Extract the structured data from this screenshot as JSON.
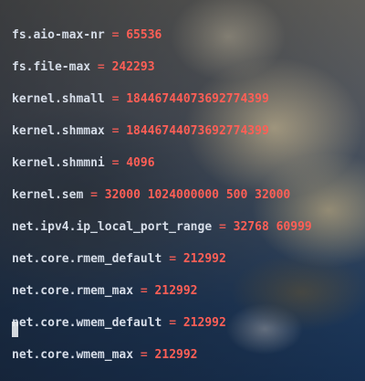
{
  "terminal": {
    "lines": [
      {
        "key": "fs.aio-max-nr",
        "op": " = ",
        "value": "65536"
      },
      {
        "key": "fs.file-max",
        "op": " = ",
        "value": "242293"
      },
      {
        "key": "kernel.shmall",
        "op": " = ",
        "value": "18446744073692774399"
      },
      {
        "key": "kernel.shmmax",
        "op": " = ",
        "value": "18446744073692774399"
      },
      {
        "key": "kernel.shmmni",
        "op": " = ",
        "value": "4096"
      },
      {
        "key": "kernel.sem",
        "op": " = ",
        "value": "32000 1024000000 500 32000"
      },
      {
        "key": "net.ipv4.ip_local_port_range",
        "op": " = ",
        "value": "32768 60999"
      },
      {
        "key": "net.core.rmem_default",
        "op": " = ",
        "value": "212992"
      },
      {
        "key": "net.core.rmem_max",
        "op": " = ",
        "value": "212992"
      },
      {
        "key": "net.core.wmem_default",
        "op": " = ",
        "value": "212992"
      },
      {
        "key": "net.core.wmem_max",
        "op": " = ",
        "value": "212992"
      }
    ]
  },
  "colors": {
    "key": "#d6dde8",
    "value": "#ff5f56"
  }
}
